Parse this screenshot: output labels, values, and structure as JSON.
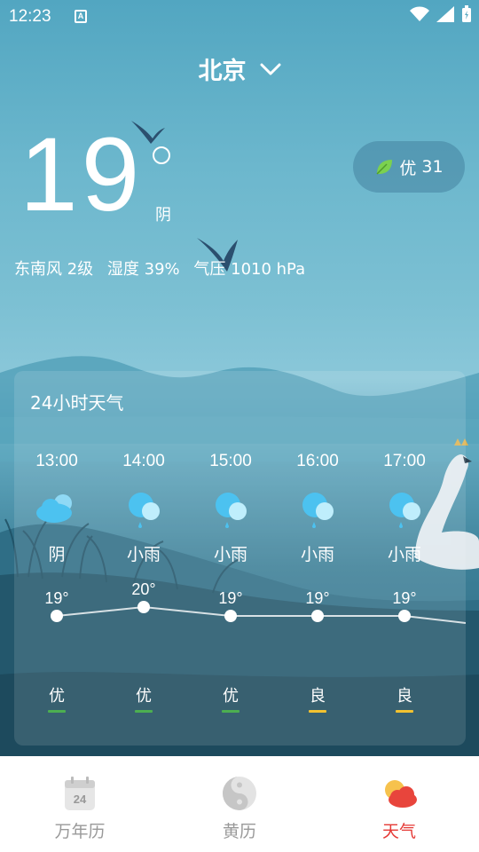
{
  "status_bar": {
    "time": "12:23",
    "notification_letter": "A",
    "icons": [
      "wifi-icon",
      "signal-icon",
      "battery-icon"
    ]
  },
  "header": {
    "city": "北京",
    "chevron_icon": "chevron-down-icon"
  },
  "current": {
    "temperature": "19",
    "condition": "阴",
    "aqi": {
      "icon": "leaf-icon",
      "level": "优",
      "value": "31"
    },
    "wind": "东南风 2级",
    "humidity": "湿度 39%",
    "pressure": "气压 1010 hPa"
  },
  "hourly": {
    "title": "24小时天气",
    "hours": [
      {
        "time": "13:00",
        "icon": "cloudy-icon",
        "condition": "阴",
        "temp": "19°",
        "temp_value": 19,
        "aq": "优",
        "aq_color": "#4caf50"
      },
      {
        "time": "14:00",
        "icon": "light-rain-icon",
        "condition": "小雨",
        "temp": "20°",
        "temp_value": 20,
        "aq": "优",
        "aq_color": "#4caf50"
      },
      {
        "time": "15:00",
        "icon": "light-rain-icon",
        "condition": "小雨",
        "temp": "19°",
        "temp_value": 19,
        "aq": "优",
        "aq_color": "#4caf50"
      },
      {
        "time": "16:00",
        "icon": "light-rain-icon",
        "condition": "小雨",
        "temp": "19°",
        "temp_value": 19,
        "aq": "良",
        "aq_color": "#f2c230"
      },
      {
        "time": "17:00",
        "icon": "light-rain-icon",
        "condition": "小雨",
        "temp": "19°",
        "temp_value": 19,
        "aq": "良",
        "aq_color": "#f2c230"
      }
    ]
  },
  "bottom_nav": {
    "items": [
      {
        "label": "万年历",
        "icon": "calendar-icon",
        "icon_text": "24",
        "active": false
      },
      {
        "label": "黄历",
        "icon": "yin-yang-icon",
        "active": false
      },
      {
        "label": "天气",
        "icon": "weather-icon",
        "active": true
      }
    ]
  },
  "colors": {
    "accent": "#e53935",
    "inactive": "#999999",
    "aq_good": "#4caf50",
    "aq_moderate": "#f2c230"
  }
}
